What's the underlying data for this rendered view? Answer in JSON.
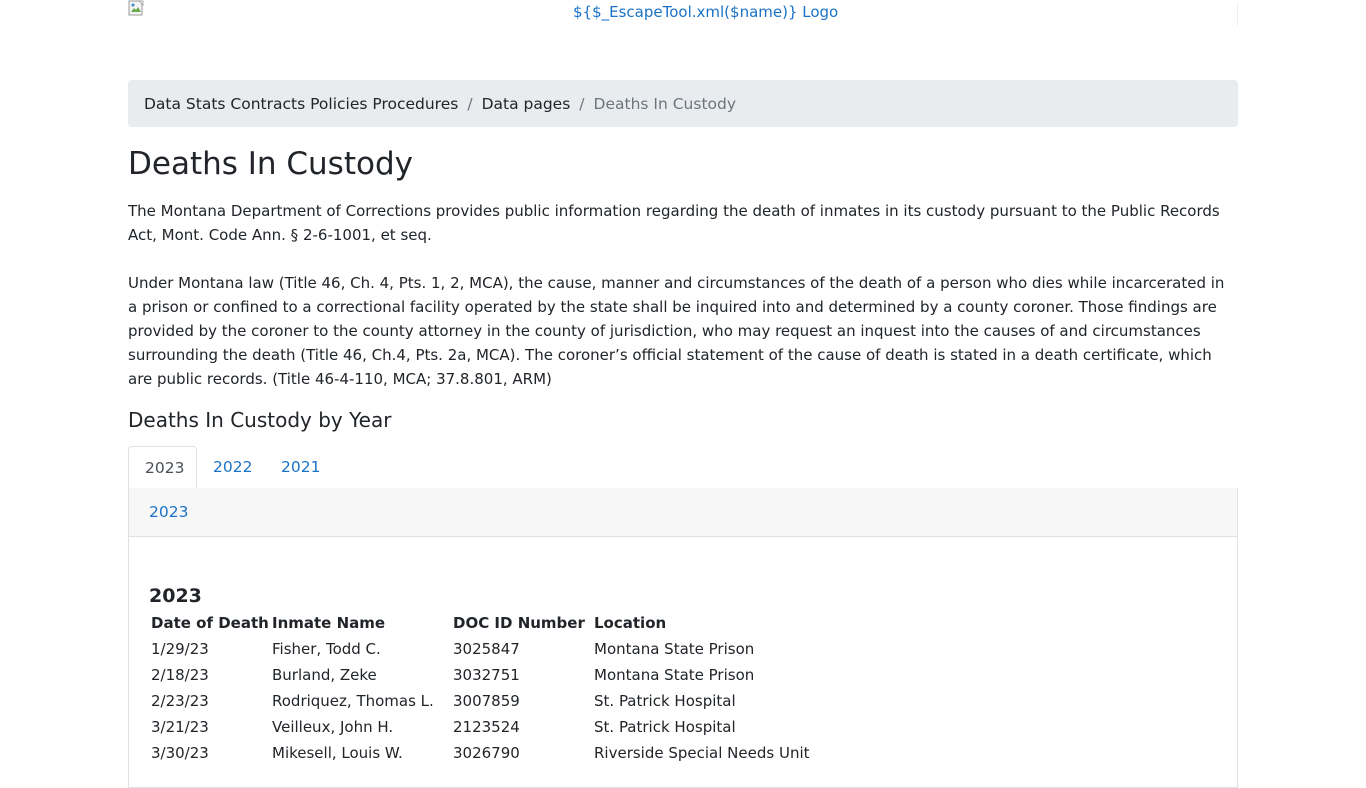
{
  "header": {
    "logo_text": "${$_EscapeTool.xml($name)} Logo"
  },
  "breadcrumb": {
    "items": [
      "Data Stats Contracts Policies Procedures",
      "Data pages"
    ],
    "current": "Deaths In Custody",
    "separator": "/"
  },
  "page": {
    "title": "Deaths In Custody",
    "paragraph_1": "The Montana Department of Corrections provides public information regarding the death of inmates in its custody pursuant to the Public Records Act, Mont. Code Ann. § 2-6-1001, et seq.",
    "paragraph_2": "Under Montana law (Title 46, Ch. 4, Pts. 1, 2, MCA), the cause, manner and circumstances of the death of a person who dies while incarcerated in a prison or confined to a correctional facility operated by the state shall be inquired into and determined by a county coroner. Those findings are provided by the coroner to the county attorney in the county of jurisdiction, who may request an inquest into the causes of and circumstances surrounding the death (Title 46, Ch.4, Pts. 2a, MCA). The coroner’s official statement of the cause of death is stated in a death certificate, which are public records. (Title 46-4-110, MCA; 37.8.801, ARM)",
    "section_title": "Deaths In Custody by Year"
  },
  "tabs": [
    {
      "label": "2023",
      "active": true
    },
    {
      "label": "2022",
      "active": false
    },
    {
      "label": "2021",
      "active": false
    }
  ],
  "panel": {
    "header_link": "2023",
    "year_heading": "2023",
    "columns": [
      "Date of Death",
      "Inmate Name",
      "DOC ID Number",
      "Location"
    ],
    "rows": [
      [
        "1/29/23",
        "Fisher, Todd C.",
        "3025847",
        "Montana State Prison"
      ],
      [
        "2/18/23",
        "Burland, Zeke",
        "3032751",
        "Montana State Prison"
      ],
      [
        "2/23/23",
        "Rodriquez, Thomas L.",
        "3007859",
        "St. Patrick Hospital"
      ],
      [
        "3/21/23",
        "Veilleux, John H.",
        "2123524",
        "St. Patrick Hospital"
      ],
      [
        "3/30/23",
        "Mikesell, Louis W.",
        "3026790",
        "Riverside Special Needs Unit"
      ]
    ]
  },
  "colors": {
    "link": "#1a73c8",
    "breadcrumb_bg": "#e9ecef",
    "card_header_bg": "#f7f7f7",
    "border": "#dee2e6"
  },
  "icons": {
    "logo": "broken-image-icon"
  }
}
